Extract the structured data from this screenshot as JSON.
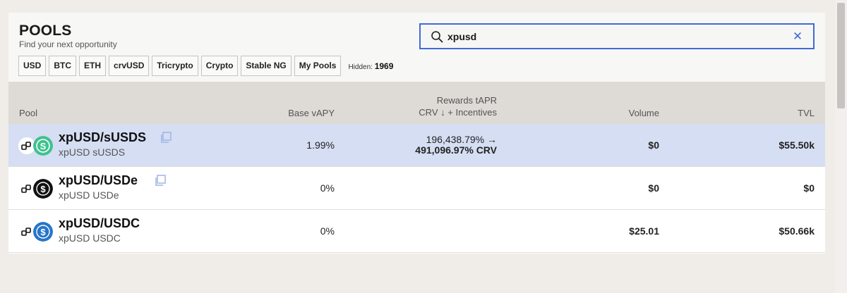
{
  "header": {
    "title": "POOLS",
    "subtitle": "Find your next opportunity"
  },
  "search": {
    "value": "xpusd",
    "placeholder": "Search"
  },
  "filters": {
    "chips": [
      "USD",
      "BTC",
      "ETH",
      "crvUSD",
      "Tricrypto",
      "Crypto",
      "Stable NG",
      "My Pools"
    ],
    "hidden_label": "Hidden:",
    "hidden_count": "1969"
  },
  "table": {
    "columns": {
      "pool": "Pool",
      "base_vapy": "Base vAPY",
      "rewards_title": "Rewards tAPR",
      "rewards_crv": "CRV",
      "rewards_sort_arrow": "↓",
      "rewards_incentives": "+ Incentives",
      "volume": "Volume",
      "tvl": "TVL"
    },
    "rows": [
      {
        "name": "xpUSD/sUSDS",
        "sub": "xpUSD sUSDS",
        "base_vapy": "1.99%",
        "rewards_line1": "196,438.79% →",
        "rewards_line2": "491,096.97% CRV",
        "volume": "$0",
        "tvl": "$55.50k",
        "highlighted": true
      },
      {
        "name": "xpUSD/USDe",
        "sub": "xpUSD USDe",
        "base_vapy": "0%",
        "rewards_line1": "",
        "rewards_line2": "",
        "volume": "$0",
        "tvl": "$0",
        "highlighted": false
      },
      {
        "name": "xpUSD/USDC",
        "sub": "xpUSD USDC",
        "base_vapy": "0%",
        "rewards_line1": "",
        "rewards_line2": "",
        "volume": "$25.01",
        "tvl": "$50.66k",
        "highlighted": false
      }
    ]
  },
  "icons": {
    "search": "search-icon",
    "clear": "close-icon",
    "copy": "copy-icon",
    "xpusd_coin": "link-coin-icon",
    "susds_coin": "susds-coin-icon",
    "usde_coin": "usde-coin-icon",
    "usdc_coin": "usdc-coin-icon"
  },
  "colors": {
    "accent": "#3f6ad8",
    "row_highlight": "#d5def3",
    "susds": "#3ec28f",
    "usde": "#111111",
    "usdc": "#2775ca"
  }
}
